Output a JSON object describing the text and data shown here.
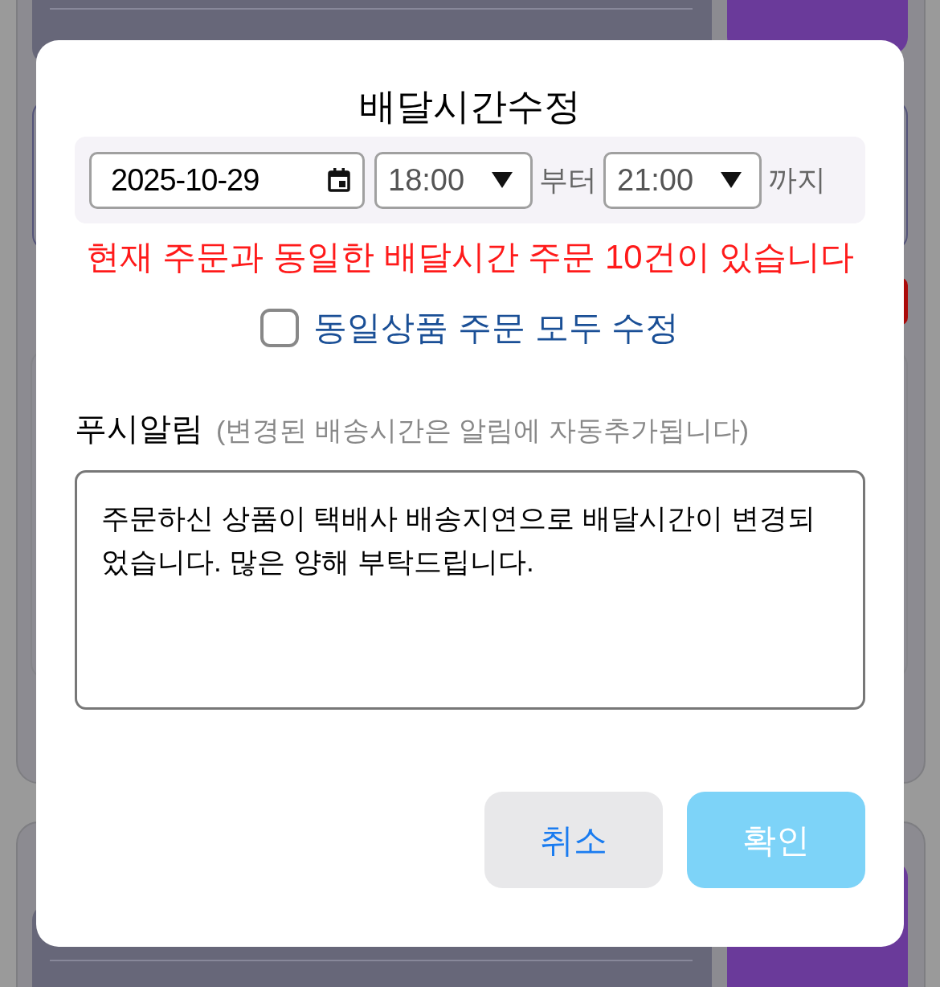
{
  "dialog": {
    "title": "배달시간수정",
    "date": {
      "value": "2025-10-29"
    },
    "start_time": {
      "value": "18:00"
    },
    "from_label": "부터",
    "end_time": {
      "value": "21:00"
    },
    "until_label": "까지",
    "warning": "현재 주문과 동일한 배달시간 주문 10건이 있습니다",
    "apply_all": {
      "label": "동일상품 주문 모두 수정",
      "checked": false
    },
    "push": {
      "label": "푸시알림",
      "hint": "(변경된 배송시간은 알림에 자동추가됩니다)",
      "message": "주문하신 상품이 택배사 배송지연으로 배달시간이 변경되었습니다. 많은 양해 부탁드립니다."
    },
    "buttons": [
      {
        "label": "취소",
        "kind": "cancel"
      },
      {
        "label": "확인",
        "kind": "confirm"
      }
    ]
  }
}
